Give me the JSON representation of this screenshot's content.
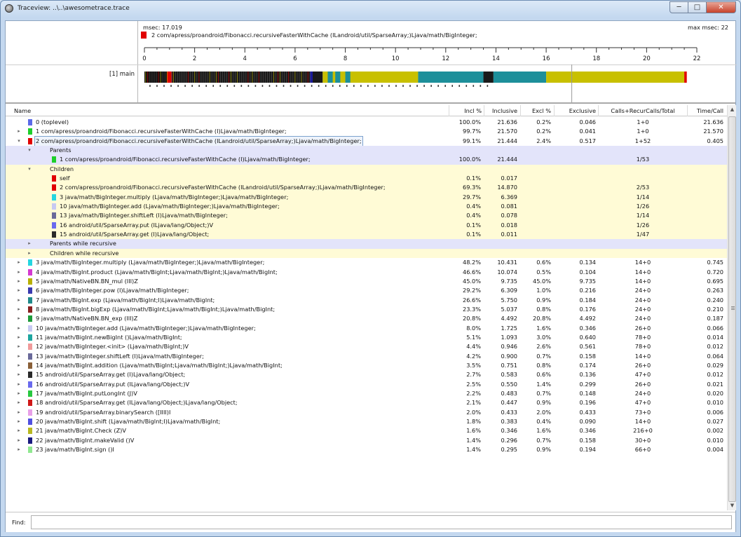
{
  "window": {
    "title": "Traceview: ..\\..\\awesometrace.trace",
    "minimize": "─",
    "maximize": "□",
    "close": "✕"
  },
  "timeline": {
    "msec_label": "msec: 17.019",
    "max_msec_label": "max msec: 22",
    "selected_method": "2 com/apress/proandroid/Fibonacci.recursiveFasterWithCache (ILandroid/util/SparseArray;)Ljava/math/BigInteger;",
    "selected_color": "#e10000",
    "ticks": [
      "0",
      "2",
      "4",
      "6",
      "8",
      "10",
      "12",
      "14",
      "16",
      "18",
      "20",
      "22"
    ],
    "thread": "[1] main",
    "bars": [
      {
        "from": 0.0,
        "to": 0.9,
        "color": "#111111"
      },
      {
        "from": 0.9,
        "to": 1.1,
        "color": "#e10000"
      },
      {
        "from": 1.1,
        "to": 6.6,
        "color": "#1a1a1a"
      },
      {
        "from": 6.6,
        "to": 6.7,
        "color": "#1a1a9a"
      },
      {
        "from": 6.7,
        "to": 7.1,
        "color": "#1a1a1a"
      },
      {
        "from": 7.1,
        "to": 10.9,
        "color": "#c8c000"
      },
      {
        "from": 7.3,
        "to": 7.5,
        "color": "#1d8f9a"
      },
      {
        "from": 7.6,
        "to": 7.8,
        "color": "#1d8f9a"
      },
      {
        "from": 8.0,
        "to": 8.2,
        "color": "#1d8f9a"
      },
      {
        "from": 10.9,
        "to": 13.5,
        "color": "#1d8f9a"
      },
      {
        "from": 13.5,
        "to": 13.9,
        "color": "#1a1a1a"
      },
      {
        "from": 13.9,
        "to": 16.0,
        "color": "#1d8f9a"
      },
      {
        "from": 16.0,
        "to": 21.5,
        "color": "#c8c000"
      },
      {
        "from": 21.5,
        "to": 21.6,
        "color": "#e10000"
      }
    ]
  },
  "columns": {
    "name": "Name",
    "incl_pct": "Incl %",
    "inclusive": "Inclusive",
    "excl_pct": "Excl %",
    "exclusive": "Exclusive",
    "calls": "Calls+RecurCalls/Total",
    "time_call": "Time/Call"
  },
  "rows": [
    {
      "kind": "method",
      "exp": "",
      "name": "0 (toplevel)",
      "color": "#5b6be8",
      "incl_pct": "100.0%",
      "inclusive": "21.636",
      "excl_pct": "0.2%",
      "exclusive": "0.046",
      "calls": "1+0",
      "time_call": "21.636"
    },
    {
      "kind": "method",
      "exp": "▸",
      "name": "1 com/apress/proandroid/Fibonacci.recursiveFasterWithCache (I)Ljava/math/BigInteger;",
      "color": "#1ecf2b",
      "incl_pct": "99.7%",
      "inclusive": "21.570",
      "excl_pct": "0.2%",
      "exclusive": "0.041",
      "calls": "1+0",
      "time_call": "21.570"
    },
    {
      "kind": "method",
      "exp": "▾",
      "selected": true,
      "name": "2 com/apress/proandroid/Fibonacci.recursiveFasterWithCache (ILandroid/util/SparseArray;)Ljava/math/BigInteger;",
      "color": "#e10000",
      "incl_pct": "99.1%",
      "inclusive": "21.444",
      "excl_pct": "2.4%",
      "exclusive": "0.517",
      "calls": "1+52",
      "time_call": "0.405"
    },
    {
      "kind": "parents-hdr",
      "exp": "▾",
      "name": "Parents"
    },
    {
      "kind": "parents-item",
      "name": "1 com/apress/proandroid/Fibonacci.recursiveFasterWithCache (I)Ljava/math/BigInteger;",
      "color": "#1ecf2b",
      "incl_pct": "100.0%",
      "inclusive": "21.444",
      "calls": "1/53"
    },
    {
      "kind": "children-hdr",
      "exp": "▾",
      "name": "Children"
    },
    {
      "kind": "child-item",
      "name": "self",
      "color": "#e10000",
      "incl_pct": "0.1%",
      "inclusive": "0.017",
      "calls": ""
    },
    {
      "kind": "child-item",
      "name": "2 com/apress/proandroid/Fibonacci.recursiveFasterWithCache (ILandroid/util/SparseArray;)Ljava/math/BigInteger;",
      "color": "#e10000",
      "incl_pct": "69.3%",
      "inclusive": "14.870",
      "calls": "2/53"
    },
    {
      "kind": "child-item",
      "name": "3 java/math/BigInteger.multiply (Ljava/math/BigInteger;)Ljava/math/BigInteger;",
      "color": "#25d6e0",
      "incl_pct": "29.7%",
      "inclusive": "6.369",
      "calls": "1/14"
    },
    {
      "kind": "child-item",
      "name": "10 java/math/BigInteger.add (Ljava/math/BigInteger;)Ljava/math/BigInteger;",
      "color": "#c7c9f2",
      "incl_pct": "0.4%",
      "inclusive": "0.081",
      "calls": "1/26"
    },
    {
      "kind": "child-item",
      "name": "13 java/math/BigInteger.shiftLeft (I)Ljava/math/BigInteger;",
      "color": "#6a6a9a",
      "incl_pct": "0.4%",
      "inclusive": "0.078",
      "calls": "1/14"
    },
    {
      "kind": "child-item",
      "name": "16 android/util/SparseArray.put (ILjava/lang/Object;)V",
      "color": "#6a6aee",
      "incl_pct": "0.1%",
      "inclusive": "0.018",
      "calls": "1/26"
    },
    {
      "kind": "child-item",
      "name": "15 android/util/SparseArray.get (I)Ljava/lang/Object;",
      "color": "#2a2a2a",
      "incl_pct": "0.1%",
      "inclusive": "0.011",
      "calls": "1/47"
    },
    {
      "kind": "pwr",
      "exp": "▸",
      "name": "Parents while recursive"
    },
    {
      "kind": "cwr",
      "exp": "▸",
      "name": "Children while recursive"
    },
    {
      "kind": "method",
      "exp": "▸",
      "name": "3 java/math/BigInteger.multiply (Ljava/math/BigInteger;)Ljava/math/BigInteger;",
      "color": "#25d6e0",
      "incl_pct": "48.2%",
      "inclusive": "10.431",
      "excl_pct": "0.6%",
      "exclusive": "0.134",
      "calls": "14+0",
      "time_call": "0.745"
    },
    {
      "kind": "method",
      "exp": "▸",
      "name": "4 java/math/BigInt.product (Ljava/math/BigInt;Ljava/math/BigInt;)Ljava/math/BigInt;",
      "color": "#d43ad0",
      "incl_pct": "46.6%",
      "inclusive": "10.074",
      "excl_pct": "0.5%",
      "exclusive": "0.104",
      "calls": "14+0",
      "time_call": "0.720"
    },
    {
      "kind": "method",
      "exp": "▸",
      "name": "5 java/math/NativeBN.BN_mul (III)Z",
      "color": "#b8b000",
      "incl_pct": "45.0%",
      "inclusive": "9.735",
      "excl_pct": "45.0%",
      "exclusive": "9.735",
      "calls": "14+0",
      "time_call": "0.695"
    },
    {
      "kind": "method",
      "exp": "▸",
      "name": "6 java/math/BigInteger.pow (I)Ljava/math/BigInteger;",
      "color": "#3a3ab0",
      "incl_pct": "29.2%",
      "inclusive": "6.309",
      "excl_pct": "1.0%",
      "exclusive": "0.216",
      "calls": "24+0",
      "time_call": "0.263"
    },
    {
      "kind": "method",
      "exp": "▸",
      "name": "7 java/math/BigInt.exp (Ljava/math/BigInt;I)Ljava/math/BigInt;",
      "color": "#1f8a8a",
      "incl_pct": "26.6%",
      "inclusive": "5.750",
      "excl_pct": "0.9%",
      "exclusive": "0.184",
      "calls": "24+0",
      "time_call": "0.240"
    },
    {
      "kind": "method",
      "exp": "▸",
      "name": "8 java/math/BigInt.bigExp (Ljava/math/BigInt;Ljava/math/BigInt;)Ljava/math/BigInt;",
      "color": "#8a2020",
      "incl_pct": "23.3%",
      "inclusive": "5.037",
      "excl_pct": "0.8%",
      "exclusive": "0.176",
      "calls": "24+0",
      "time_call": "0.210"
    },
    {
      "kind": "method",
      "exp": "▸",
      "name": "9 java/math/NativeBN.BN_exp (III)Z",
      "color": "#1d9a3a",
      "incl_pct": "20.8%",
      "inclusive": "4.492",
      "excl_pct": "20.8%",
      "exclusive": "4.492",
      "calls": "24+0",
      "time_call": "0.187"
    },
    {
      "kind": "method",
      "exp": "▸",
      "name": "10 java/math/BigInteger.add (Ljava/math/BigInteger;)Ljava/math/BigInteger;",
      "color": "#c7c9f2",
      "incl_pct": "8.0%",
      "inclusive": "1.725",
      "excl_pct": "1.6%",
      "exclusive": "0.346",
      "calls": "26+0",
      "time_call": "0.066"
    },
    {
      "kind": "method",
      "exp": "▸",
      "name": "11 java/math/BigInt.newBigInt ()Ljava/math/BigInt;",
      "color": "#1ea6a0",
      "incl_pct": "5.1%",
      "inclusive": "1.093",
      "excl_pct": "3.0%",
      "exclusive": "0.640",
      "calls": "78+0",
      "time_call": "0.014"
    },
    {
      "kind": "method",
      "exp": "▸",
      "name": "12 java/math/BigInteger.<init> (Ljava/math/BigInt;)V",
      "color": "#f09a9a",
      "incl_pct": "4.4%",
      "inclusive": "0.946",
      "excl_pct": "2.6%",
      "exclusive": "0.561",
      "calls": "78+0",
      "time_call": "0.012"
    },
    {
      "kind": "method",
      "exp": "▸",
      "name": "13 java/math/BigInteger.shiftLeft (I)Ljava/math/BigInteger;",
      "color": "#6a6a9a",
      "incl_pct": "4.2%",
      "inclusive": "0.900",
      "excl_pct": "0.7%",
      "exclusive": "0.158",
      "calls": "14+0",
      "time_call": "0.064"
    },
    {
      "kind": "method",
      "exp": "▸",
      "name": "14 java/math/BigInt.addition (Ljava/math/BigInt;Ljava/math/BigInt;)Ljava/math/BigInt;",
      "color": "#8a6038",
      "incl_pct": "3.5%",
      "inclusive": "0.751",
      "excl_pct": "0.8%",
      "exclusive": "0.174",
      "calls": "26+0",
      "time_call": "0.029"
    },
    {
      "kind": "method",
      "exp": "▸",
      "name": "15 android/util/SparseArray.get (I)Ljava/lang/Object;",
      "color": "#2a2a2a",
      "incl_pct": "2.7%",
      "inclusive": "0.583",
      "excl_pct": "0.6%",
      "exclusive": "0.136",
      "calls": "47+0",
      "time_call": "0.012"
    },
    {
      "kind": "method",
      "exp": "▸",
      "name": "16 android/util/SparseArray.put (ILjava/lang/Object;)V",
      "color": "#6a6aee",
      "incl_pct": "2.5%",
      "inclusive": "0.550",
      "excl_pct": "1.4%",
      "exclusive": "0.299",
      "calls": "26+0",
      "time_call": "0.021"
    },
    {
      "kind": "method",
      "exp": "▸",
      "name": "17 java/math/BigInt.putLongInt (J)V",
      "color": "#28c840",
      "incl_pct": "2.2%",
      "inclusive": "0.483",
      "excl_pct": "0.7%",
      "exclusive": "0.148",
      "calls": "24+0",
      "time_call": "0.020"
    },
    {
      "kind": "method",
      "exp": "▸",
      "name": "18 android/util/SparseArray.get (ILjava/lang/Object;)Ljava/lang/Object;",
      "color": "#d01818",
      "incl_pct": "2.1%",
      "inclusive": "0.447",
      "excl_pct": "0.9%",
      "exclusive": "0.196",
      "calls": "47+0",
      "time_call": "0.010"
    },
    {
      "kind": "method",
      "exp": "▸",
      "name": "19 android/util/SparseArray.binarySearch ([IIII)I",
      "color": "#e8a0e8",
      "incl_pct": "2.0%",
      "inclusive": "0.433",
      "excl_pct": "2.0%",
      "exclusive": "0.433",
      "calls": "73+0",
      "time_call": "0.006"
    },
    {
      "kind": "method",
      "exp": "▸",
      "name": "20 java/math/BigInt.shift (Ljava/math/BigInt;I)Ljava/math/BigInt;",
      "color": "#5050e0",
      "incl_pct": "1.8%",
      "inclusive": "0.383",
      "excl_pct": "0.4%",
      "exclusive": "0.090",
      "calls": "14+0",
      "time_call": "0.027"
    },
    {
      "kind": "method",
      "exp": "▸",
      "name": "21 java/math/BigInt.Check (Z)V",
      "color": "#b8b820",
      "incl_pct": "1.6%",
      "inclusive": "0.346",
      "excl_pct": "1.6%",
      "exclusive": "0.346",
      "calls": "216+0",
      "time_call": "0.002"
    },
    {
      "kind": "method",
      "exp": "▸",
      "name": "22 java/math/BigInt.makeValid ()V",
      "color": "#1a1a80",
      "incl_pct": "1.4%",
      "inclusive": "0.296",
      "excl_pct": "0.7%",
      "exclusive": "0.158",
      "calls": "30+0",
      "time_call": "0.010"
    },
    {
      "kind": "method",
      "exp": "▸",
      "name": "23 java/math/BigInt.sign ()I",
      "color": "#90e890",
      "incl_pct": "1.4%",
      "inclusive": "0.295",
      "excl_pct": "0.9%",
      "exclusive": "0.194",
      "calls": "66+0",
      "time_call": "0.004"
    }
  ],
  "find": {
    "label": "Find:",
    "value": ""
  }
}
